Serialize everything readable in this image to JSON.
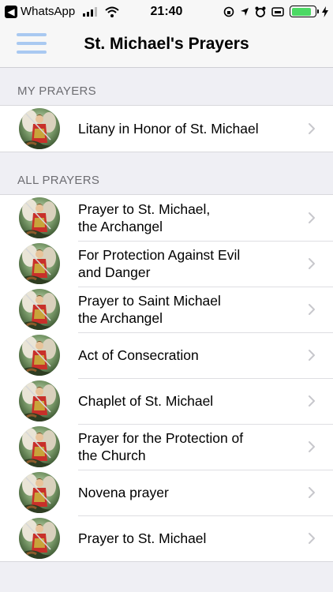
{
  "status_bar": {
    "back_app": "WhatsApp",
    "back_glyph": "◀",
    "time": "21:40",
    "battery_level": 0.85
  },
  "nav": {
    "title": "St. Michael's Prayers",
    "menu_icon": "hamburger-icon"
  },
  "sections": {
    "my_prayers": {
      "header": "MY PRAYERS",
      "items": [
        {
          "label": "Litany in Honor of St. Michael"
        }
      ]
    },
    "all_prayers": {
      "header": "ALL PRAYERS",
      "items": [
        {
          "line1": "Prayer to St. Michael,",
          "line2": "the Archangel"
        },
        {
          "line1": "For Protection Against Evil",
          "line2": "and Danger"
        },
        {
          "line1": "Prayer to Saint Michael",
          "line2": "the Archangel"
        },
        {
          "line1": "Act of Consecration",
          "line2": ""
        },
        {
          "line1": "Chaplet of St. Michael",
          "line2": ""
        },
        {
          "line1": "Prayer for the Protection of",
          "line2": "the Church"
        },
        {
          "line1": "Novena prayer",
          "line2": ""
        },
        {
          "line1": "Prayer to St. Michael",
          "line2": ""
        }
      ]
    }
  },
  "colors": {
    "accent": "#a9c9f1",
    "background": "#efeff4",
    "section_header": "#6d6d72",
    "battery": "#4cd964"
  }
}
